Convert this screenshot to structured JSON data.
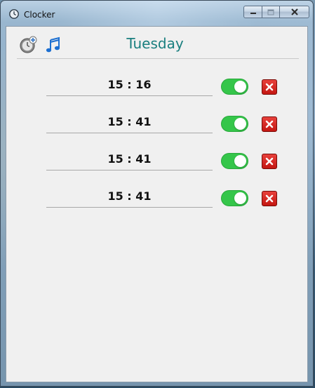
{
  "window": {
    "title": "Clocker"
  },
  "header": {
    "day": "Tuesday"
  },
  "alarms": [
    {
      "time": "15 : 16",
      "enabled": true
    },
    {
      "time": "15 : 41",
      "enabled": true
    },
    {
      "time": "15 : 41",
      "enabled": true
    },
    {
      "time": "15 : 41",
      "enabled": true
    }
  ],
  "colors": {
    "day_title": "#1a7f7f",
    "toggle_on": "#35c64a",
    "delete": "#d12a24"
  },
  "icons": {
    "title": "clock-icon",
    "add_alarm": "add-alarm-clock-icon",
    "music": "music-note-icon",
    "delete": "close-x-icon"
  }
}
